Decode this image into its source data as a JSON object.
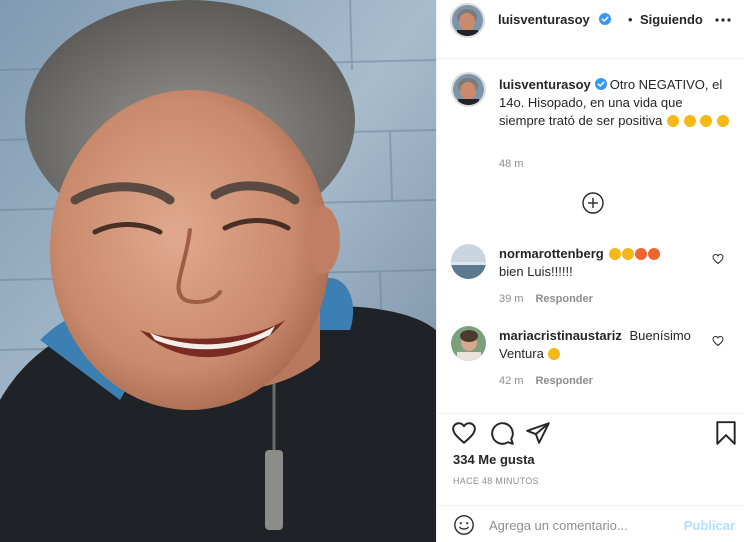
{
  "post": {
    "username": "luisventurasoy",
    "dot": "•",
    "following_label": "Siguiendo",
    "verified_color": "#3897f0"
  },
  "caption": {
    "username": "luisventurasoy",
    "text": "Otro NEGATIVO, el 14o. Hisopado, en una vida que siempre trató de ser positiva",
    "emoji": [
      "rolling-on-floor-laughing-emoji",
      "rolling-on-floor-laughing-emoji",
      "rolling-on-floor-laughing-emoji",
      "rolling-on-floor-laughing-emoji"
    ],
    "time": "48 m"
  },
  "comments": [
    {
      "username": "normarottenberg",
      "text": "bien Luis!!!!!!",
      "emoji": [
        "face-screaming-in-fear-emoji",
        "face-screaming-in-fear-emoji",
        "smiling-face-with-heart-eyes-emoji",
        "smiling-face-with-heart-eyes-emoji"
      ],
      "time": "39 m",
      "reply_label": "Responder"
    },
    {
      "username": "mariacristinaustariz",
      "text_before": "Buenísimo",
      "text_after": "Ventura",
      "emoji": [
        "face-screaming-in-fear-emoji"
      ],
      "time": "42 m",
      "reply_label": "Responder"
    }
  ],
  "likes": "334 Me gusta",
  "time_ago": "HACE 48 MINUTOS",
  "add_comment": {
    "placeholder": "Agrega un comentario...",
    "publish_label": "Publicar"
  },
  "icons": {
    "more": "more-horizontal-icon",
    "load_more": "plus-circle-icon",
    "like": "heart-icon",
    "comment": "comment-icon",
    "share": "paper-plane-icon",
    "save": "bookmark-icon",
    "emoji": "smile-icon"
  }
}
